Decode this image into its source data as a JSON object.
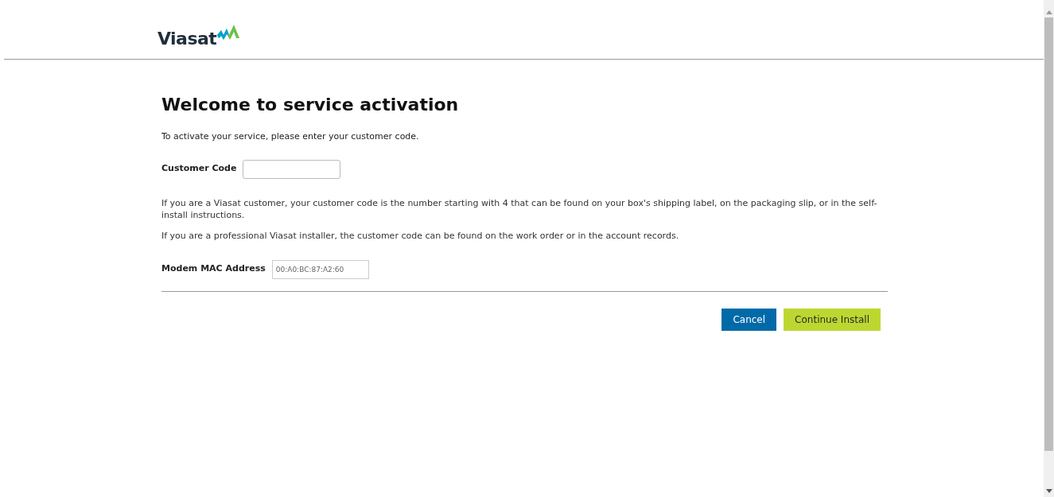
{
  "header": {
    "logo_text": "Viasat"
  },
  "title": "Welcome to service activation",
  "intro": "To activate your service, please enter your customer code.",
  "customer_code": {
    "label": "Customer Code"
  },
  "help": [
    "If you are a Viasat customer, your customer code is the number starting with 4 that can be found on your box's shipping label, on the packaging slip, or in the self-install instructions.",
    "If you are a professional Viasat installer, the customer code can be found on the work order or in the account records."
  ],
  "mac": {
    "label": "Modem MAC Address",
    "value": "00:A0:BC:87:A2:60"
  },
  "buttons": [
    {
      "label": "Cancel",
      "kind": "secondary"
    },
    {
      "label": "Continue Install",
      "kind": "primary"
    }
  ]
}
